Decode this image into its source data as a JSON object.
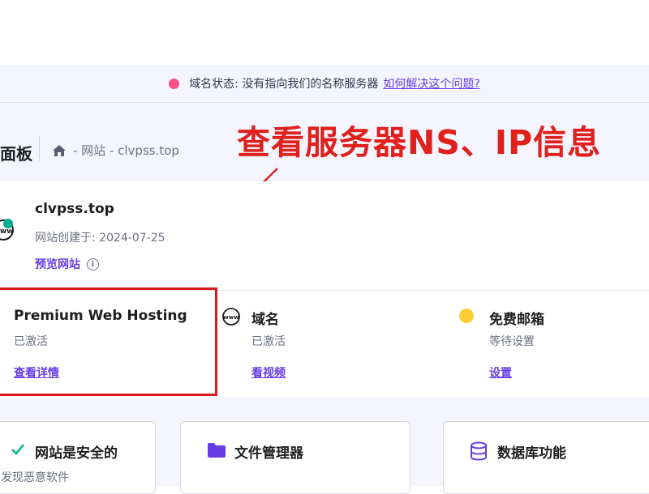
{
  "notice": {
    "text": "域名状态: 没有指向我们的名称服务器",
    "link": "如何解决这个问题?",
    "dot_color": "#fc5185"
  },
  "header": {
    "panel_title": "面板",
    "breadcrumb": "- 网站 - clvpss.top"
  },
  "annotation": {
    "text": "查看服务器NS、IP信息",
    "color": "#e0201b"
  },
  "site": {
    "name": "clvpss.top",
    "created": "网站创建于: 2024-07-25",
    "preview": "预览网站"
  },
  "services": [
    {
      "title": "Premium Web Hosting",
      "status": "已激活",
      "link": "查看详情",
      "icon": "none"
    },
    {
      "title": "域名",
      "status": "已激活",
      "link": "看视频",
      "icon": "www-icon"
    },
    {
      "title": "免费邮箱",
      "status": "等待设置",
      "link": "设置",
      "icon": "yellow-dot-icon"
    }
  ],
  "cards": [
    {
      "title": "网站是安全的",
      "sub": "发现恶意软件",
      "icon": "check-icon"
    },
    {
      "title": "文件管理器",
      "icon": "folder-icon"
    },
    {
      "title": "数据库功能",
      "icon": "database-icon"
    }
  ],
  "colors": {
    "accent": "#673de6",
    "background": "#f4f5ff",
    "highlight": "#d7181d"
  }
}
